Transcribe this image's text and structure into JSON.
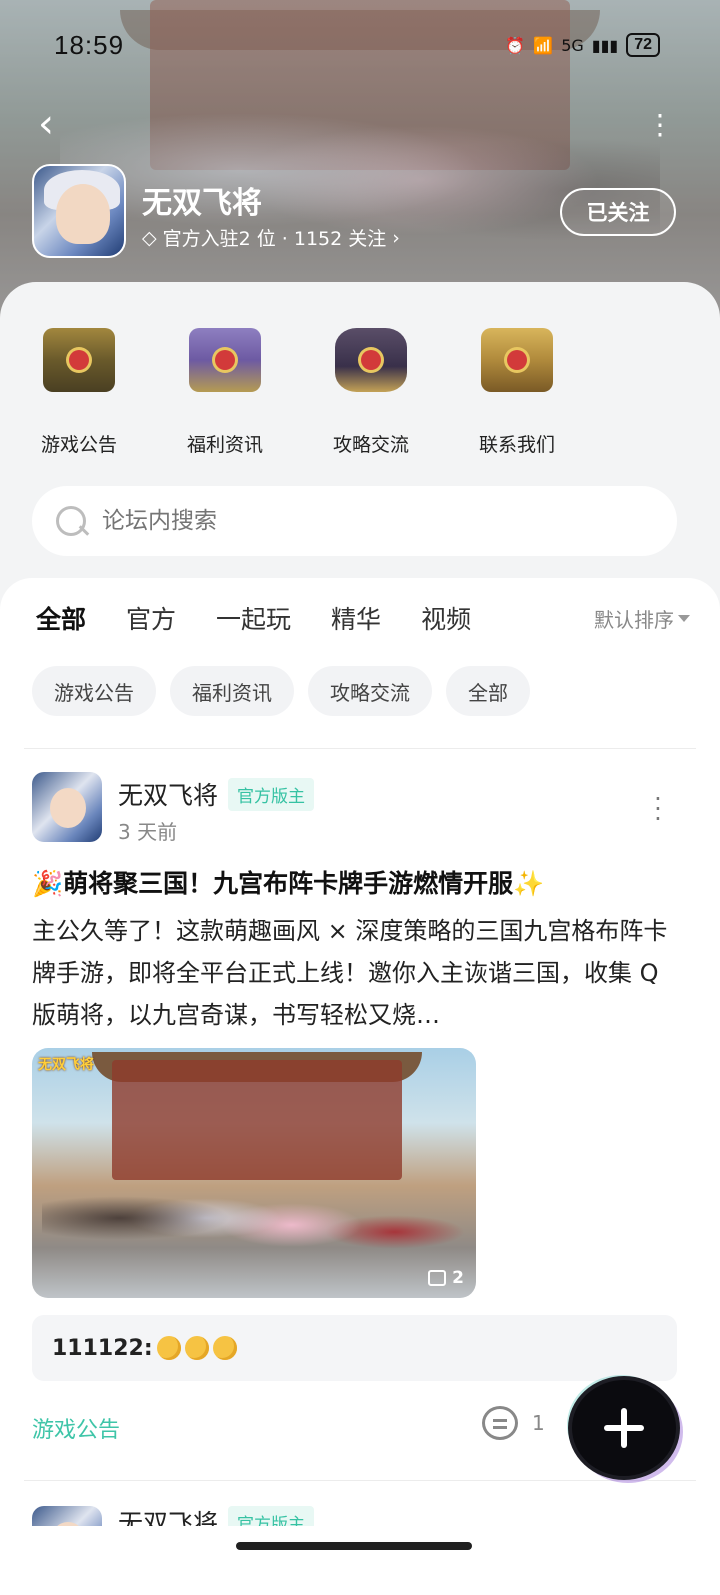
{
  "status_bar": {
    "time": "18:59",
    "network": "5G",
    "battery": "72"
  },
  "header": {
    "game_name": "无双飞将",
    "meta": "官方入驻2 位 · 1152 关注",
    "follow_label": "已关注"
  },
  "quick_links": [
    {
      "label": "游戏公告",
      "icon": "chest-gold-icon"
    },
    {
      "label": "福利资讯",
      "icon": "chest-purple-icon"
    },
    {
      "label": "攻略交流",
      "icon": "chest-dark-icon"
    },
    {
      "label": "联系我们",
      "icon": "chest-golden-icon"
    }
  ],
  "search": {
    "placeholder": "论坛内搜索"
  },
  "tabs": [
    {
      "label": "全部",
      "active": true
    },
    {
      "label": "官方"
    },
    {
      "label": "一起玩"
    },
    {
      "label": "精华"
    },
    {
      "label": "视频"
    }
  ],
  "sort_label": "默认排序",
  "chips": [
    "游戏公告",
    "福利资讯",
    "攻略交流",
    "全部"
  ],
  "post": {
    "author": "无双飞将",
    "badge": "官方版主",
    "time": "3 天前",
    "title": "🎉萌将聚三国！九宫布阵卡牌手游燃情开服✨",
    "body": "主公久等了！这款萌趣画风 × 深度策略的三国九宫格布阵卡牌手游，即将全平台正式上线！邀你入主诙谐三国，收集 Q 版萌将，以九宫奇谋，书写轻松又烧…",
    "image_logo": "无双飞将",
    "image_count": "2",
    "comment_user": "111122:",
    "category": "游戏公告",
    "comment_count": "1"
  },
  "next_post": {
    "author": "无双飞将",
    "badge": "官方版主"
  },
  "colors": {
    "accent": "#3fc5a8",
    "badge_bg": "#e8f8f4",
    "fab": "#0b0b0f"
  }
}
